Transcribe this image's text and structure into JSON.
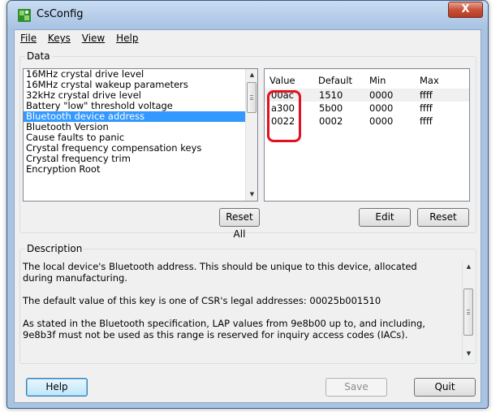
{
  "window": {
    "title": "CsConfig",
    "close_glyph": "X",
    "app_icon": "puzzle-piece-icon"
  },
  "menu": [
    "File",
    "Keys",
    "View",
    "Help"
  ],
  "data_group": {
    "label": "Data",
    "items": [
      "16MHz crystal drive level",
      "16MHz crystal wakeup parameters",
      "32kHz crystal drive level",
      "Battery \"low\" threshold voltage",
      "Bluetooth device address",
      "Bluetooth Version",
      "Cause faults to panic",
      "Crystal frequency compensation keys",
      "Crystal frequency trim",
      "Encryption Root"
    ],
    "selected_index": 4,
    "reset_all_label": "Reset All"
  },
  "values": {
    "headers": [
      "Value",
      "Default",
      "Min",
      "Max"
    ],
    "rows": [
      {
        "value": "00ac",
        "default": "1510",
        "min": "0000",
        "max": "ffff"
      },
      {
        "value": "a300",
        "default": "5b00",
        "min": "0000",
        "max": "ffff"
      },
      {
        "value": "0022",
        "default": "0002",
        "min": "0000",
        "max": "ffff"
      }
    ],
    "edit_label": "Edit",
    "reset_label": "Reset"
  },
  "description": {
    "label": "Description",
    "lines": [
      "The local device's Bluetooth address.  This should be unique to this device, allocated during manufacturing.",
      "The default value of this key is one of CSR's legal addresses: 00025b001510",
      "As stated in the Bluetooth specification, LAP values from 9e8b00 up to, and including, 9e8b3f must not be used as this range is reserved for inquiry access codes (IACs)."
    ]
  },
  "footer": {
    "help_label": "Help",
    "save_label": "Save",
    "quit_label": "Quit"
  },
  "colors": {
    "selection": "#3399ff",
    "annotation": "#e3101f"
  }
}
